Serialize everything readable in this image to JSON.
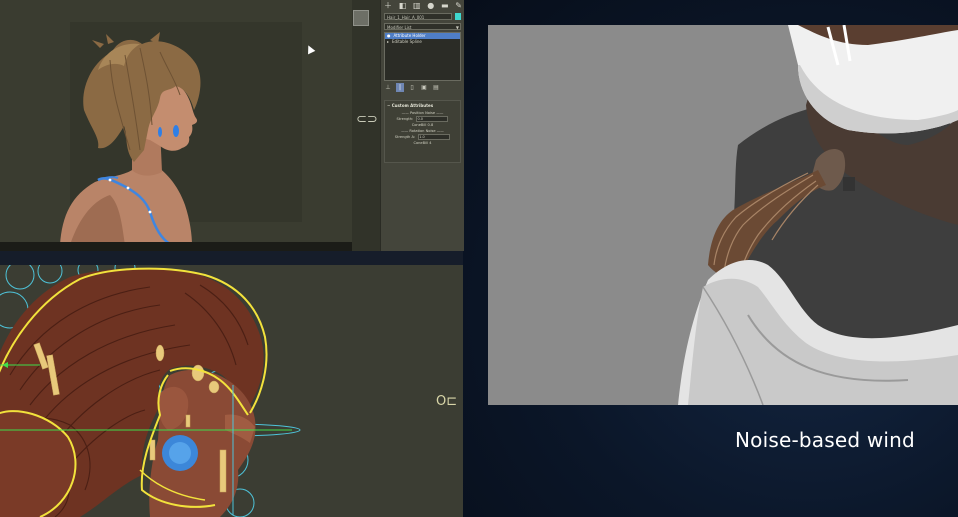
{
  "panel": {
    "object_name": "Hair_1_Hair_A_001",
    "object_color": "#3fd8cf",
    "modifier_list_label": "Modifier List",
    "toolbar_icons": [
      "create-icon",
      "modify-icon",
      "hierarchy-icon",
      "motion-icon",
      "display-icon",
      "utilities-icon"
    ],
    "stack_items": [
      {
        "label": "Attribute Holder",
        "selected": true
      },
      {
        "label": "Editable Spline",
        "selected": false
      }
    ],
    "stack_tool_icons": [
      "pin-stack-icon",
      "show-end-result-icon",
      "make-unique-icon",
      "remove-modifier-icon",
      "configure-sets-icon"
    ],
    "custom_attributes": {
      "title": "Custom Attributes",
      "position_noise_header": "Position Noise",
      "strength_label": "Strength:",
      "strength_value": "0.0",
      "coneoffset_label": "ConeBill",
      "coneoffset_value": "0.8",
      "rotation_noise_header": "Rotation Noise",
      "strength_a_label": "Strength A:",
      "strength_a_value": "1.0",
      "coneoffset2_label": "ConeBill",
      "coneoffset2_value": "4"
    }
  },
  "caption": "Noise-based wind",
  "colors": {
    "viewport_bg": "#3a3c30",
    "selection_yellow": "#f2e23c",
    "spline_cyan": "#4ec3d9",
    "accent_blue": "#3f86e0",
    "background_navy": "#0a1322"
  }
}
